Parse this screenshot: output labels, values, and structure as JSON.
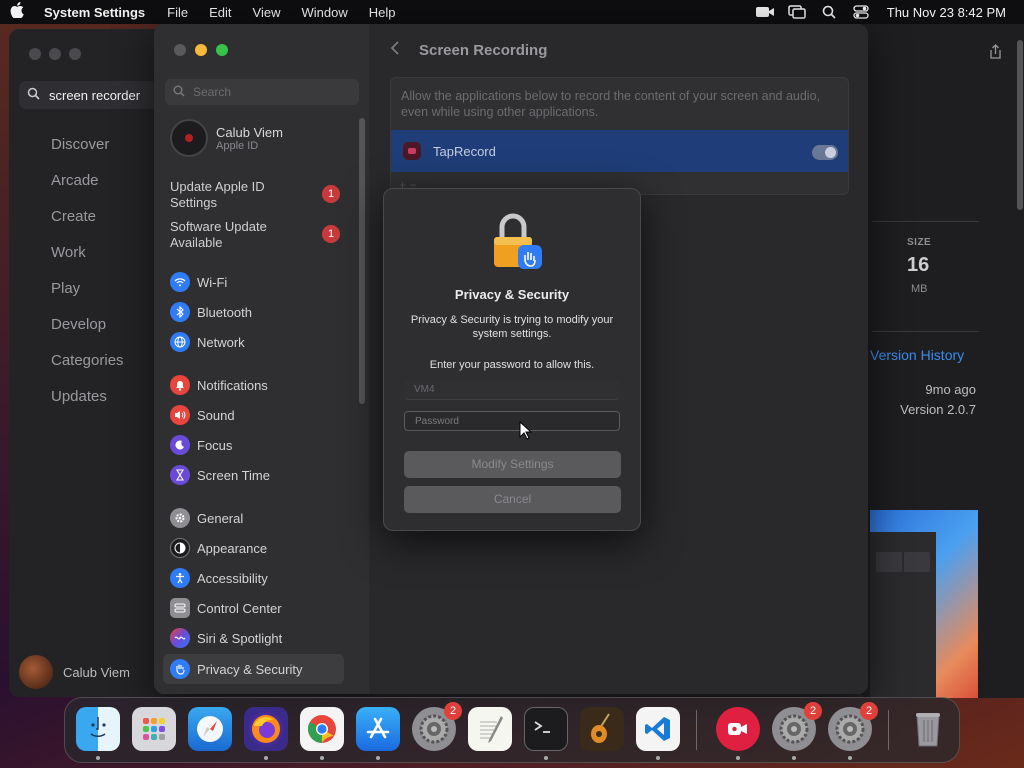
{
  "menubar": {
    "app_name": "System Settings",
    "menus": [
      "File",
      "Edit",
      "View",
      "Window",
      "Help"
    ],
    "clock": "Thu Nov 23  8:42 PM"
  },
  "appstore": {
    "search_value": "screen recorder",
    "nav": [
      "Discover",
      "Arcade",
      "Create",
      "Work",
      "Play",
      "Develop",
      "Categories",
      "Updates"
    ],
    "user_name": "Calub Viem",
    "size_label": "SIZE",
    "size_value": "16",
    "size_unit": "MB",
    "version_history": "Version History",
    "updated_ago": "9mo ago",
    "version": "Version 2.0.7"
  },
  "settings": {
    "search_placeholder": "Search",
    "account": {
      "name": "Calub Viem",
      "sub": "Apple ID"
    },
    "updates": [
      {
        "label": "Update Apple ID Settings",
        "badge": "1"
      },
      {
        "label": "Software Update Available",
        "badge": "1"
      }
    ],
    "items": [
      {
        "label": "Wi-Fi",
        "color": "#2f7cf6",
        "icon": "wifi-icon"
      },
      {
        "label": "Bluetooth",
        "color": "#2f7cf6",
        "icon": "bluetooth-icon"
      },
      {
        "label": "Network",
        "color": "#2f7cf6",
        "icon": "globe-icon"
      },
      {
        "label": "Notifications",
        "color": "#e8453c",
        "icon": "bell-icon"
      },
      {
        "label": "Sound",
        "color": "#e8453c",
        "icon": "speaker-icon"
      },
      {
        "label": "Focus",
        "color": "#6a4ad8",
        "icon": "moon-icon"
      },
      {
        "label": "Screen Time",
        "color": "#6a4ad8",
        "icon": "hourglass-icon"
      },
      {
        "label": "General",
        "color": "#8e8e93",
        "icon": "gear-icon"
      },
      {
        "label": "Appearance",
        "color": "#1c1c1e",
        "icon": "appearance-icon"
      },
      {
        "label": "Accessibility",
        "color": "#2f7cf6",
        "icon": "accessibility-icon"
      },
      {
        "label": "Control Center",
        "color": "#8e8e93",
        "icon": "control-center-icon"
      },
      {
        "label": "Siri & Spotlight",
        "color": "#b04ad8",
        "icon": "siri-icon"
      },
      {
        "label": "Privacy & Security",
        "color": "#2f7cf6",
        "icon": "hand-icon"
      }
    ],
    "main": {
      "title": "Screen Recording",
      "description": "Allow the applications below to record the content of your screen and audio, even while using other applications.",
      "app": "TapRecord",
      "add_remove": "+  −"
    }
  },
  "dialog": {
    "title": "Privacy & Security",
    "body": "Privacy & Security is trying to modify your system settings.",
    "prompt": "Enter your password to allow this.",
    "username": "VM4",
    "password_placeholder": "Password",
    "modify_button": "Modify Settings",
    "cancel_button": "Cancel"
  },
  "dock": {
    "badges": {
      "system_settings_1": "2",
      "system_settings_2": "2",
      "system_settings_3": "2"
    }
  }
}
